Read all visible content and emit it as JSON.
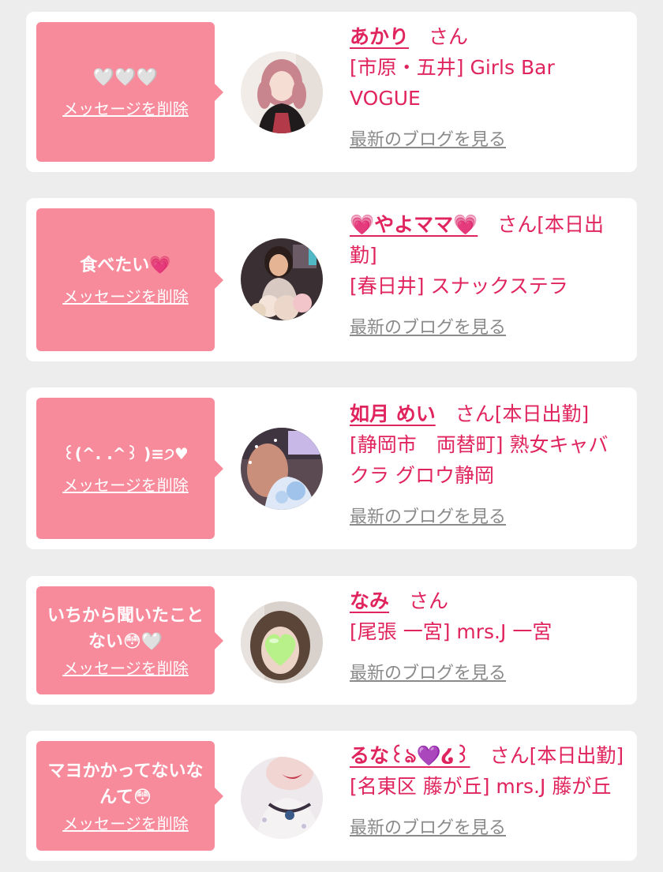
{
  "cards": [
    {
      "message": "🤍🤍🤍",
      "delete_label": "メッセージを削除",
      "name": "あかり",
      "honorific": "　さん",
      "shop": "[市原・五井] Girls Bar VOGUE",
      "blog_link": "最新のブログを見る"
    },
    {
      "message": "食べたい💗",
      "delete_label": "メッセージを削除",
      "name": "💗やよママ💗",
      "honorific": "　さん[本日出勤]",
      "shop": "[春日井] スナックステラ",
      "blog_link": "最新のブログを見る"
    },
    {
      "message": "꒰(^. .^꒱ )≡੭♥",
      "delete_label": "メッセージを削除",
      "name": "如月 めい",
      "honorific": "　さん[本日出勤]",
      "shop": "[静岡市　両替町] 熟女キャバクラ グロウ静岡",
      "blog_link": "最新のブログを見る"
    },
    {
      "message": "いちから聞いたことない😳🤍",
      "delete_label": "メッセージを削除",
      "name": "なみ",
      "honorific": "　さん",
      "shop": "[尾張 一宮] mrs.J 一宮",
      "blog_link": "最新のブログを見る"
    },
    {
      "message": "マヨかかってないなんて😳",
      "delete_label": "メッセージを削除",
      "name": "るな꒰ঌ💜໒꒱",
      "honorific": "　さん[本日出勤]",
      "shop": "[名東区 藤が丘] mrs.J 藤が丘",
      "blog_link": "最新のブログを見る"
    }
  ],
  "colors": {
    "background": "#ededed",
    "card": "#ffffff",
    "bubble": "#f78b9c",
    "accent": "#e0245e",
    "link_gray": "#8a8a8a"
  }
}
